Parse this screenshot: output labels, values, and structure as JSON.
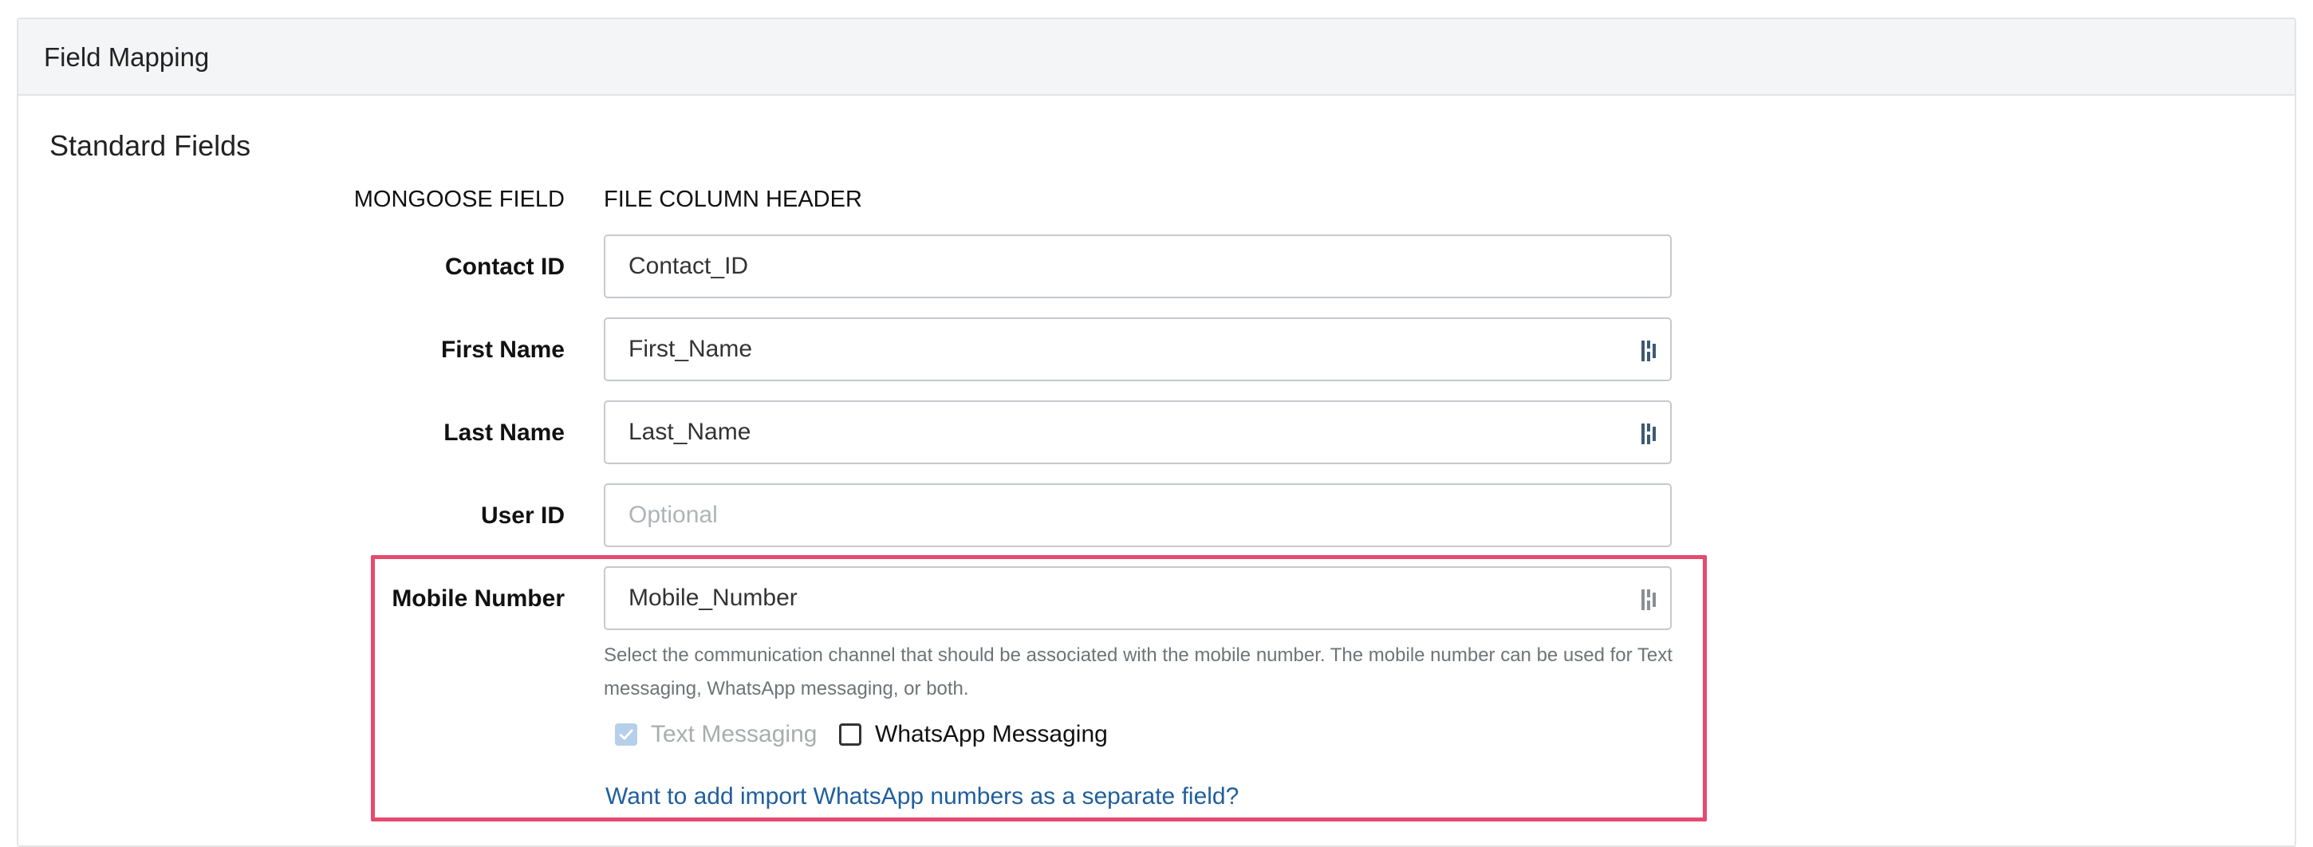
{
  "panel": {
    "title": "Field Mapping"
  },
  "section": {
    "title": "Standard Fields",
    "column_left": "MONGOOSE FIELD",
    "column_right": "FILE COLUMN HEADER"
  },
  "fields": [
    {
      "label": "Contact ID",
      "value": "Contact_ID",
      "placeholder": "",
      "has_picker": false
    },
    {
      "label": "First Name",
      "value": "First_Name",
      "placeholder": "",
      "has_picker": true
    },
    {
      "label": "Last Name",
      "value": "Last_Name",
      "placeholder": "",
      "has_picker": true
    },
    {
      "label": "User ID",
      "value": "",
      "placeholder": "Optional",
      "has_picker": false
    },
    {
      "label": "Mobile Number",
      "value": "Mobile_Number",
      "placeholder": "",
      "has_picker": true
    }
  ],
  "mobile_channel": {
    "help_text": "Select the communication channel that should be associated with the mobile number. The mobile number can be used for Text messaging, WhatsApp messaging, or both.",
    "text_messaging_label": "Text Messaging",
    "text_messaging_checked": true,
    "text_messaging_disabled": true,
    "whatsapp_label": "WhatsApp Messaging",
    "whatsapp_checked": false,
    "separate_field_link": "Want to add import WhatsApp numbers as a separate field?"
  },
  "colors": {
    "highlight_border": "#e54a6f",
    "link": "#1f5f9e",
    "picker_icon": "#3d5a73"
  },
  "icons": {
    "picker": "column-picker-icon",
    "checkmark": "checkmark-icon"
  }
}
